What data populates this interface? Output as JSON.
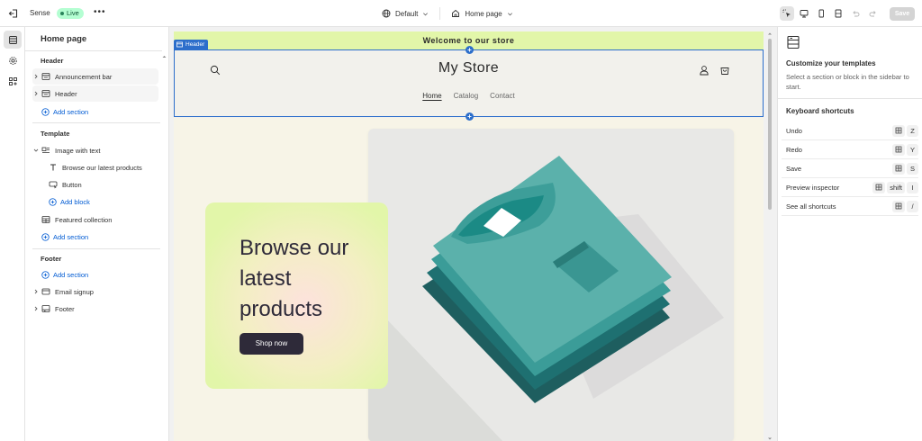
{
  "topbar": {
    "theme_name": "Sense",
    "status": "Live",
    "more": "•••",
    "template_label": "Default",
    "page_label": "Home page",
    "save_label": "Save"
  },
  "sidebar": {
    "title": "Home page",
    "sections": {
      "header": {
        "heading": "Header",
        "items": [
          "Announcement bar",
          "Header"
        ],
        "add_section": "Add section"
      },
      "template": {
        "heading": "Template",
        "image_with_text": "Image with text",
        "blocks": [
          "Browse our latest products",
          "Button"
        ],
        "add_block": "Add block",
        "featured_collection": "Featured collection",
        "add_section": "Add section"
      },
      "footer": {
        "heading": "Footer",
        "add_section": "Add section",
        "items": [
          "Email signup",
          "Footer"
        ]
      }
    }
  },
  "preview": {
    "announcement": "Welcome to our store",
    "selected_tag": "Header",
    "store_name": "My Store",
    "nav": [
      "Home",
      "Catalog",
      "Contact"
    ],
    "hero": {
      "heading": "Browse our latest products",
      "button": "Shop now"
    },
    "colors": {
      "announcement_bg": "#e2f6a9",
      "accent": "#2c6ecb",
      "button_bg": "#2e2a39",
      "shirt": "#5bb1ab",
      "shirt_dark": "#1e6b6c"
    }
  },
  "inspector": {
    "title": "Customize your templates",
    "description": "Select a section or block in the sidebar to start.",
    "shortcuts_title": "Keyboard shortcuts",
    "shortcuts": [
      {
        "label": "Undo",
        "key": "Z"
      },
      {
        "label": "Redo",
        "key": "Y"
      },
      {
        "label": "Save",
        "key": "S"
      },
      {
        "label": "Preview inspector",
        "key": "I",
        "mod": "shift"
      },
      {
        "label": "See all shortcuts",
        "key": "/"
      }
    ]
  }
}
